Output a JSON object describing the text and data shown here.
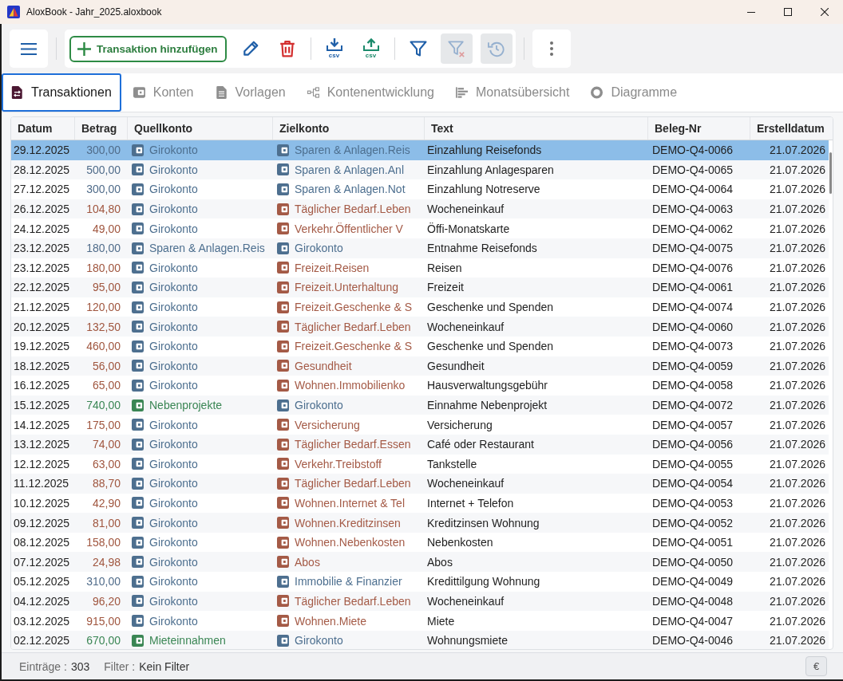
{
  "window": {
    "title": "AloxBook - Jahr_2025.aloxbook"
  },
  "toolbar": {
    "groups": [
      [
        {
          "kind": "add",
          "label": "Transaktion hinzufügen",
          "disabled": false
        },
        {
          "kind": "edit",
          "disabled": false
        },
        {
          "kind": "delete",
          "disabled": false
        }
      ],
      [
        {
          "kind": "export",
          "label": "csv",
          "disabled": false
        },
        {
          "kind": "import",
          "label": "csv",
          "disabled": false
        }
      ],
      [
        {
          "kind": "filter",
          "disabled": false
        },
        {
          "kind": "clear-filter",
          "disabled": true
        },
        {
          "kind": "undo",
          "disabled": true
        }
      ]
    ]
  },
  "tabs": [
    {
      "label": "Transaktionen",
      "kind": "transactions",
      "selected": true
    },
    {
      "label": "Konten",
      "kind": "accounts",
      "selected": false
    },
    {
      "label": "Vorlagen",
      "kind": "templates",
      "selected": false
    },
    {
      "label": "Kontenentwicklung",
      "kind": "development",
      "selected": false
    },
    {
      "label": "Monatsübersicht",
      "kind": "monthly",
      "selected": false
    },
    {
      "label": "Diagramme",
      "kind": "charts",
      "selected": false
    }
  ],
  "table": {
    "columns": [
      "Datum",
      "Betrag",
      "Quellkonto",
      "Zielkonto",
      "Text",
      "Beleg-Nr",
      "Erstelldatum"
    ],
    "rows": [
      {
        "date": "29.12.2025",
        "amount": "300,00",
        "source": {
          "name": "Girokonto",
          "kind": "asset"
        },
        "target": {
          "name": "Sparen & Anlagen.Reis",
          "kind": "asset"
        },
        "text": "Einzahlung Reisefonds",
        "receipt": "DEMO-Q4-0066",
        "created": "21.07.2026",
        "selected": true
      },
      {
        "date": "28.12.2025",
        "amount": "500,00",
        "source": {
          "name": "Girokonto",
          "kind": "asset"
        },
        "target": {
          "name": "Sparen & Anlagen.Anl",
          "kind": "asset"
        },
        "text": "Einzahlung Anlagesparen",
        "receipt": "DEMO-Q4-0065",
        "created": "21.07.2026",
        "selected": false
      },
      {
        "date": "27.12.2025",
        "amount": "300,00",
        "source": {
          "name": "Girokonto",
          "kind": "asset"
        },
        "target": {
          "name": "Sparen & Anlagen.Not",
          "kind": "asset"
        },
        "text": "Einzahlung Notreserve",
        "receipt": "DEMO-Q4-0064",
        "created": "21.07.2026",
        "selected": false
      },
      {
        "date": "26.12.2025",
        "amount": "104,80",
        "source": {
          "name": "Girokonto",
          "kind": "asset"
        },
        "target": {
          "name": "Täglicher Bedarf.Leben",
          "kind": "expense"
        },
        "text": "Wocheneinkauf",
        "receipt": "DEMO-Q4-0063",
        "created": "21.07.2026",
        "selected": false
      },
      {
        "date": "24.12.2025",
        "amount": "49,00",
        "source": {
          "name": "Girokonto",
          "kind": "asset"
        },
        "target": {
          "name": "Verkehr.Öffentlicher V",
          "kind": "expense"
        },
        "text": "Öffi-Monatskarte",
        "receipt": "DEMO-Q4-0062",
        "created": "21.07.2026",
        "selected": false
      },
      {
        "date": "23.12.2025",
        "amount": "180,00",
        "source": {
          "name": "Sparen & Anlagen.Reis",
          "kind": "asset"
        },
        "target": {
          "name": "Girokonto",
          "kind": "asset"
        },
        "text": "Entnahme Reisefonds",
        "receipt": "DEMO-Q4-0075",
        "created": "21.07.2026",
        "selected": false
      },
      {
        "date": "23.12.2025",
        "amount": "180,00",
        "source": {
          "name": "Girokonto",
          "kind": "asset"
        },
        "target": {
          "name": "Freizeit.Reisen",
          "kind": "expense"
        },
        "text": "Reisen",
        "receipt": "DEMO-Q4-0076",
        "created": "21.07.2026",
        "selected": false
      },
      {
        "date": "22.12.2025",
        "amount": "95,00",
        "source": {
          "name": "Girokonto",
          "kind": "asset"
        },
        "target": {
          "name": "Freizeit.Unterhaltung",
          "kind": "expense"
        },
        "text": "Freizeit",
        "receipt": "DEMO-Q4-0061",
        "created": "21.07.2026",
        "selected": false
      },
      {
        "date": "21.12.2025",
        "amount": "120,00",
        "source": {
          "name": "Girokonto",
          "kind": "asset"
        },
        "target": {
          "name": "Freizeit.Geschenke & S",
          "kind": "expense"
        },
        "text": "Geschenke und Spenden",
        "receipt": "DEMO-Q4-0074",
        "created": "21.07.2026",
        "selected": false
      },
      {
        "date": "20.12.2025",
        "amount": "132,50",
        "source": {
          "name": "Girokonto",
          "kind": "asset"
        },
        "target": {
          "name": "Täglicher Bedarf.Leben",
          "kind": "expense"
        },
        "text": "Wocheneinkauf",
        "receipt": "DEMO-Q4-0060",
        "created": "21.07.2026",
        "selected": false
      },
      {
        "date": "19.12.2025",
        "amount": "460,00",
        "source": {
          "name": "Girokonto",
          "kind": "asset"
        },
        "target": {
          "name": "Freizeit.Geschenke & S",
          "kind": "expense"
        },
        "text": "Geschenke und Spenden",
        "receipt": "DEMO-Q4-0073",
        "created": "21.07.2026",
        "selected": false
      },
      {
        "date": "18.12.2025",
        "amount": "56,00",
        "source": {
          "name": "Girokonto",
          "kind": "asset"
        },
        "target": {
          "name": "Gesundheit",
          "kind": "expense"
        },
        "text": "Gesundheit",
        "receipt": "DEMO-Q4-0059",
        "created": "21.07.2026",
        "selected": false
      },
      {
        "date": "16.12.2025",
        "amount": "65,00",
        "source": {
          "name": "Girokonto",
          "kind": "asset"
        },
        "target": {
          "name": "Wohnen.Immobilienko",
          "kind": "expense"
        },
        "text": "Hausverwaltungsgebühr",
        "receipt": "DEMO-Q4-0058",
        "created": "21.07.2026",
        "selected": false
      },
      {
        "date": "15.12.2025",
        "amount": "740,00",
        "source": {
          "name": "Nebenprojekte",
          "kind": "income"
        },
        "target": {
          "name": "Girokonto",
          "kind": "asset"
        },
        "text": "Einnahme Nebenprojekt",
        "receipt": "DEMO-Q4-0072",
        "created": "21.07.2026",
        "selected": false
      },
      {
        "date": "14.12.2025",
        "amount": "175,00",
        "source": {
          "name": "Girokonto",
          "kind": "asset"
        },
        "target": {
          "name": "Versicherung",
          "kind": "expense"
        },
        "text": "Versicherung",
        "receipt": "DEMO-Q4-0057",
        "created": "21.07.2026",
        "selected": false
      },
      {
        "date": "13.12.2025",
        "amount": "74,00",
        "source": {
          "name": "Girokonto",
          "kind": "asset"
        },
        "target": {
          "name": "Täglicher Bedarf.Essen",
          "kind": "expense"
        },
        "text": "Café oder Restaurant",
        "receipt": "DEMO-Q4-0056",
        "created": "21.07.2026",
        "selected": false
      },
      {
        "date": "12.12.2025",
        "amount": "63,00",
        "source": {
          "name": "Girokonto",
          "kind": "asset"
        },
        "target": {
          "name": "Verkehr.Treibstoff",
          "kind": "expense"
        },
        "text": "Tankstelle",
        "receipt": "DEMO-Q4-0055",
        "created": "21.07.2026",
        "selected": false
      },
      {
        "date": "11.12.2025",
        "amount": "88,70",
        "source": {
          "name": "Girokonto",
          "kind": "asset"
        },
        "target": {
          "name": "Täglicher Bedarf.Leben",
          "kind": "expense"
        },
        "text": "Wocheneinkauf",
        "receipt": "DEMO-Q4-0054",
        "created": "21.07.2026",
        "selected": false
      },
      {
        "date": "10.12.2025",
        "amount": "42,90",
        "source": {
          "name": "Girokonto",
          "kind": "asset"
        },
        "target": {
          "name": "Wohnen.Internet & Tel",
          "kind": "expense"
        },
        "text": "Internet + Telefon",
        "receipt": "DEMO-Q4-0053",
        "created": "21.07.2026",
        "selected": false
      },
      {
        "date": "09.12.2025",
        "amount": "81,00",
        "source": {
          "name": "Girokonto",
          "kind": "asset"
        },
        "target": {
          "name": "Wohnen.Kreditzinsen",
          "kind": "expense"
        },
        "text": "Kreditzinsen Wohnung",
        "receipt": "DEMO-Q4-0052",
        "created": "21.07.2026",
        "selected": false
      },
      {
        "date": "08.12.2025",
        "amount": "158,00",
        "source": {
          "name": "Girokonto",
          "kind": "asset"
        },
        "target": {
          "name": "Wohnen.Nebenkosten",
          "kind": "expense"
        },
        "text": "Nebenkosten",
        "receipt": "DEMO-Q4-0051",
        "created": "21.07.2026",
        "selected": false
      },
      {
        "date": "07.12.2025",
        "amount": "24,98",
        "source": {
          "name": "Girokonto",
          "kind": "asset"
        },
        "target": {
          "name": "Abos",
          "kind": "expense"
        },
        "text": "Abos",
        "receipt": "DEMO-Q4-0050",
        "created": "21.07.2026",
        "selected": false
      },
      {
        "date": "05.12.2025",
        "amount": "310,00",
        "source": {
          "name": "Girokonto",
          "kind": "asset"
        },
        "target": {
          "name": "Immobilie & Finanzier",
          "kind": "asset"
        },
        "text": "Kredittilgung Wohnung",
        "receipt": "DEMO-Q4-0049",
        "created": "21.07.2026",
        "selected": false
      },
      {
        "date": "04.12.2025",
        "amount": "96,20",
        "source": {
          "name": "Girokonto",
          "kind": "asset"
        },
        "target": {
          "name": "Täglicher Bedarf.Leben",
          "kind": "expense"
        },
        "text": "Wocheneinkauf",
        "receipt": "DEMO-Q4-0048",
        "created": "21.07.2026",
        "selected": false
      },
      {
        "date": "03.12.2025",
        "amount": "915,00",
        "source": {
          "name": "Girokonto",
          "kind": "asset"
        },
        "target": {
          "name": "Wohnen.Miete",
          "kind": "expense"
        },
        "text": "Miete",
        "receipt": "DEMO-Q4-0047",
        "created": "21.07.2026",
        "selected": false
      },
      {
        "date": "02.12.2025",
        "amount": "670,00",
        "source": {
          "name": "Mieteinnahmen",
          "kind": "income"
        },
        "target": {
          "name": "Girokonto",
          "kind": "asset"
        },
        "text": "Wohnungsmiete",
        "receipt": "DEMO-Q4-0046",
        "created": "21.07.2026",
        "selected": false
      }
    ]
  },
  "status_bar": {
    "entries_label": "Einträge :",
    "entries_value": "303",
    "filter_label": "Filter :",
    "filter_value": "Kein Filter",
    "currency_button": "€"
  }
}
